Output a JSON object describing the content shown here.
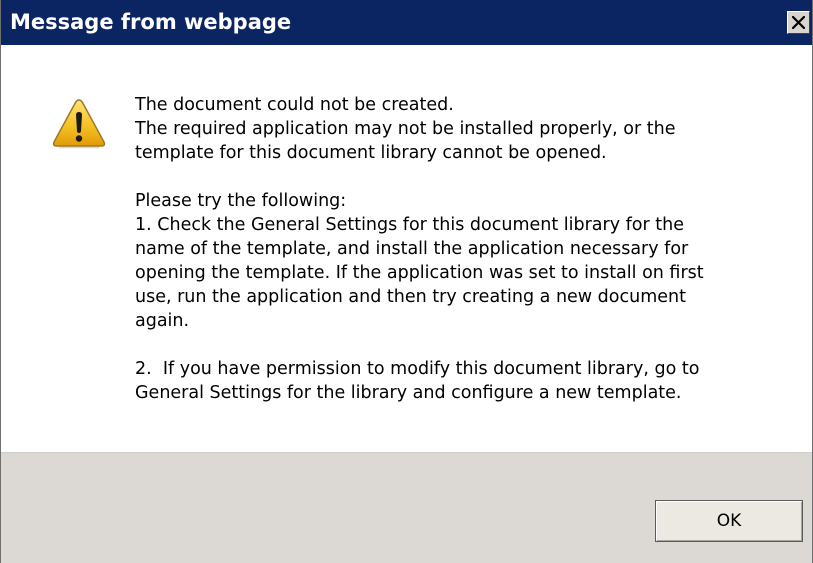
{
  "window": {
    "title": "Message from webpage",
    "close_label": "×"
  },
  "message": {
    "paragraph1": "The document could not be created.\nThe required application may not be installed properly, or the\ntemplate for this document library cannot be opened.",
    "paragraph2": "Please try the following:\n1. Check the General Settings for this document library for the\nname of the template, and install the application necessary for\nopening the template. If the application was set to install on first\nuse, run the application and then try creating a new document\nagain.",
    "paragraph3": "2.  If you have permission to modify this document library, go to\nGeneral Settings for the library and configure a new template."
  },
  "buttons": {
    "ok_label": "OK"
  },
  "icons": {
    "warning": "warning-icon",
    "close": "close-icon"
  },
  "colors": {
    "titlebar": "#0b2462",
    "footer": "#dcd9d4",
    "warning_yellow": "#f6c324"
  }
}
